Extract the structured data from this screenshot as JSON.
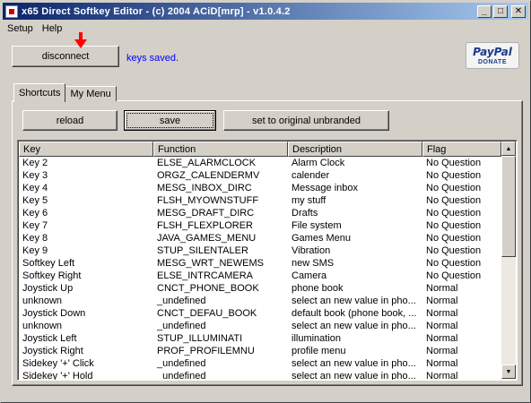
{
  "window": {
    "title": "x65 Direct Softkey Editor - (c) 2004 ACiD[mrp] - v1.0.4.2",
    "controls": {
      "minimize": "_",
      "maximize": "□",
      "close": "✕"
    }
  },
  "menu": {
    "items": [
      "Setup",
      "Help"
    ]
  },
  "top": {
    "disconnect_label": "disconnect",
    "status": "keys saved.",
    "paypal": {
      "logo": "PayPal",
      "donate": "DONATE"
    }
  },
  "tabs": [
    {
      "label": "Shortcuts",
      "active": true
    },
    {
      "label": "My Menu",
      "active": false
    }
  ],
  "toolbar": {
    "reload_label": "reload",
    "save_label": "save",
    "reset_label": "set to original unbranded"
  },
  "table": {
    "columns": [
      "Key",
      "Function",
      "Description",
      "Flag"
    ],
    "sorted_column": "Flag",
    "rows": [
      [
        "Key 2",
        "ELSE_ALARMCLOCK",
        "Alarm Clock",
        "No Question"
      ],
      [
        "Key 3",
        "ORGZ_CALENDERMV",
        "calender",
        "No Question"
      ],
      [
        "Key 4",
        "MESG_INBOX_DIRC",
        "Message inbox",
        "No Question"
      ],
      [
        "Key 5",
        "FLSH_MYOWNSTUFF",
        "my stuff",
        "No Question"
      ],
      [
        "Key 6",
        "MESG_DRAFT_DIRC",
        "Drafts",
        "No Question"
      ],
      [
        "Key 7",
        "FLSH_FLEXPLORER",
        "File system",
        "No Question"
      ],
      [
        "Key 8",
        "JAVA_GAMES_MENU",
        "Games Menu",
        "No Question"
      ],
      [
        "Key 9",
        "STUP_SILENTALER",
        "Vibration",
        "No Question"
      ],
      [
        "Softkey Left",
        "MESG_WRT_NEWEMS",
        "new SMS",
        "No Question"
      ],
      [
        "Softkey Right",
        "ELSE_INTRCAMERA",
        "Camera",
        "No Question"
      ],
      [
        "Joystick Up",
        "CNCT_PHONE_BOOK",
        "phone book",
        "Normal"
      ],
      [
        "unknown",
        "_undefined",
        "select an new value in pho...",
        "Normal"
      ],
      [
        "Joystick Down",
        "CNCT_DEFAU_BOOK",
        "default book (phone book, ...",
        "Normal"
      ],
      [
        "unknown",
        "_undefined",
        "select an new value in pho...",
        "Normal"
      ],
      [
        "Joystick Left",
        "STUP_ILLUMINATI",
        "illumination",
        "Normal"
      ],
      [
        "Joystick Right",
        "PROF_PROFILEMNU",
        "profile menu",
        "Normal"
      ],
      [
        "Sidekey '+' Click",
        "_undefined",
        "select an new value in pho...",
        "Normal"
      ],
      [
        "Sidekey '+' Hold",
        "_undefined",
        "select an new value in pho...",
        "Normal"
      ]
    ]
  },
  "colors": {
    "status_text": "#0000ff",
    "arrow": "#ff0000",
    "titlebar_start": "#0a246a",
    "titlebar_end": "#a6caf0"
  },
  "icons": {
    "app": "app-icon",
    "arrow": "down-arrow-icon",
    "scroll_up": "triangle-up-icon",
    "scroll_down": "triangle-down-icon"
  }
}
